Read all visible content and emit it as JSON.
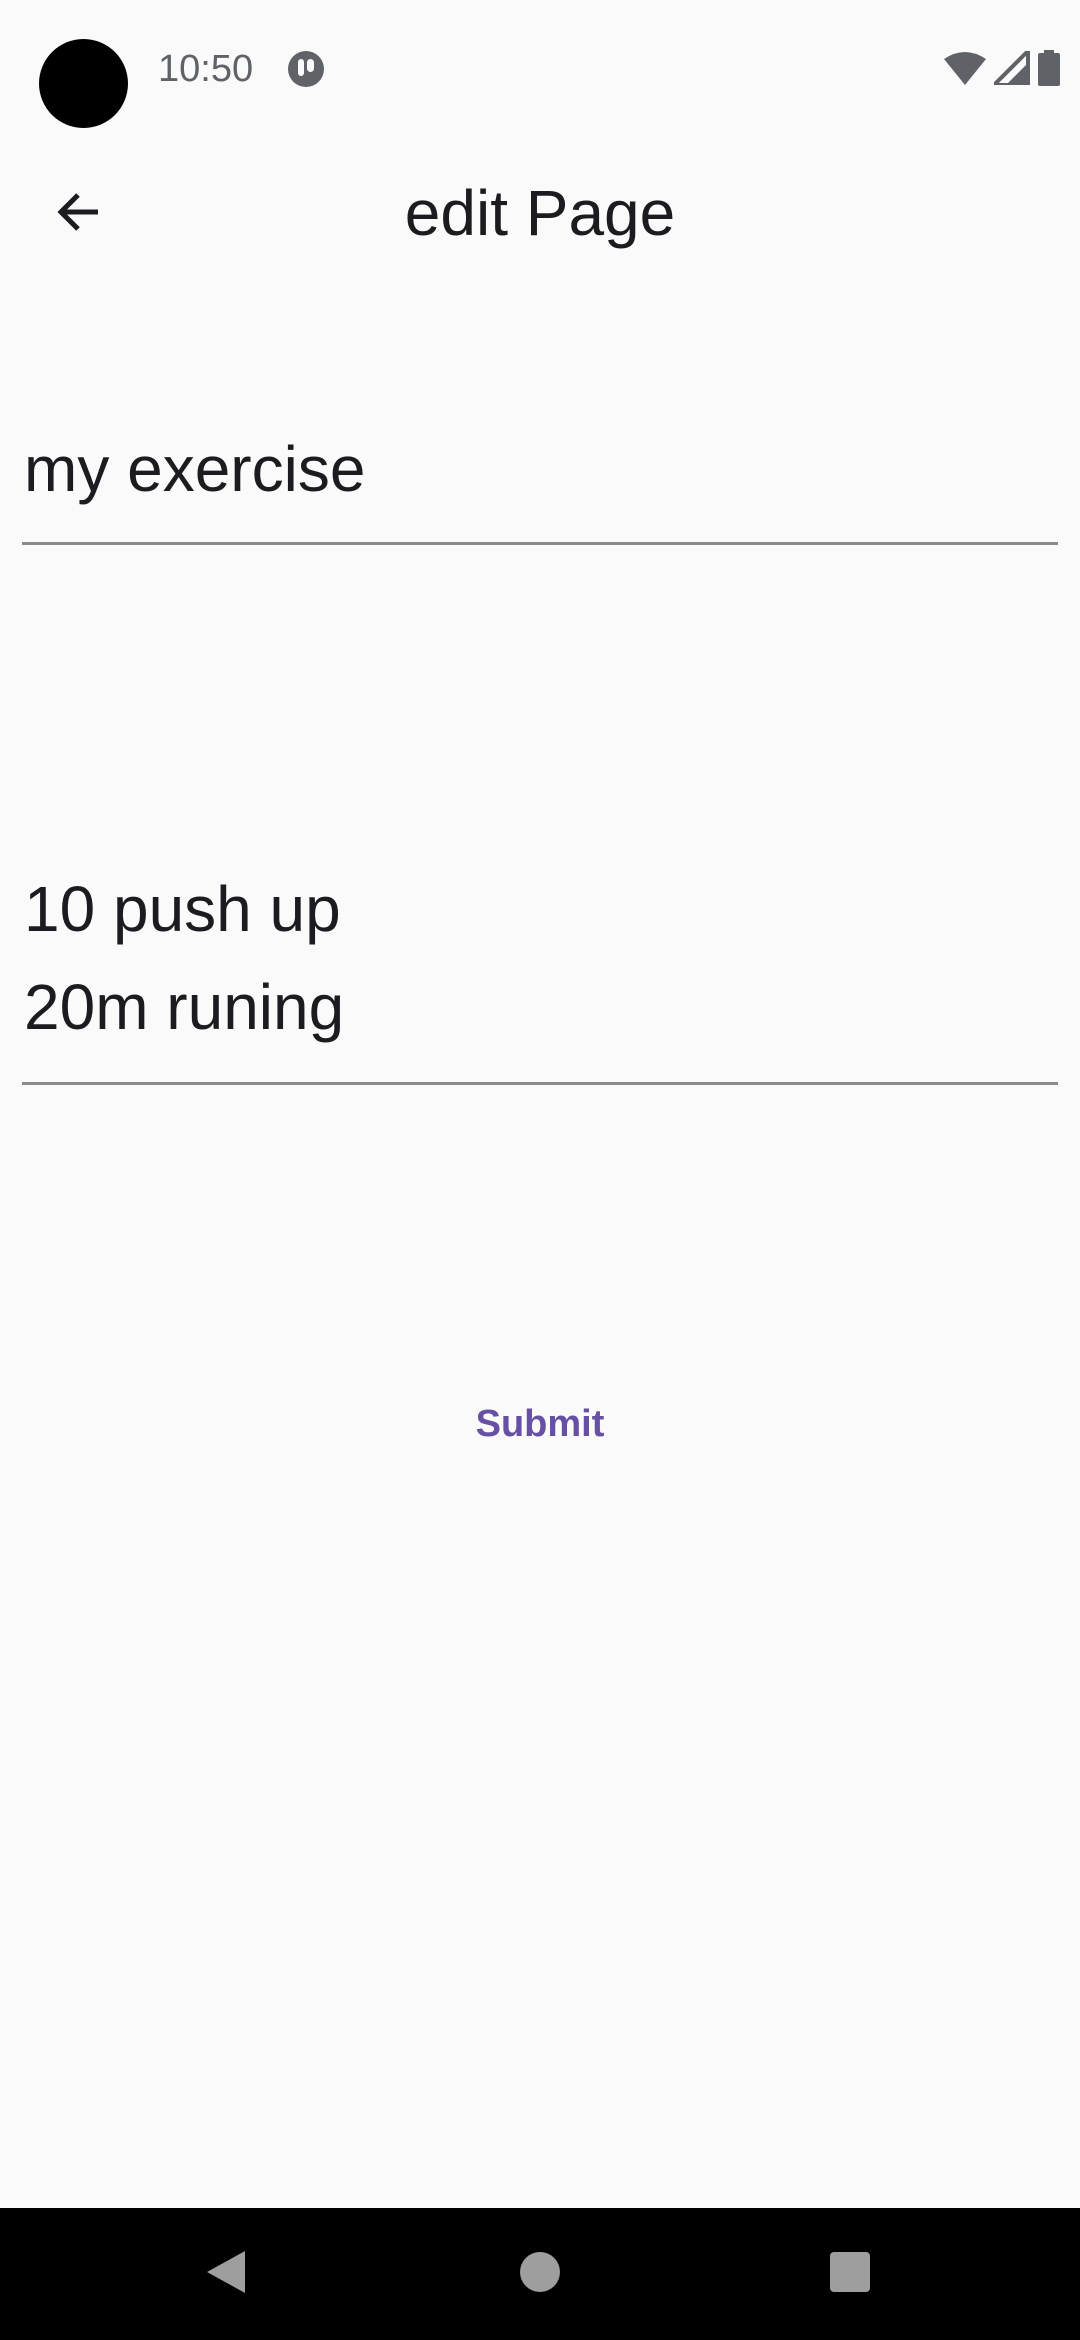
{
  "status_bar": {
    "time": "10:50",
    "icons": [
      "app-notification-icon",
      "wifi-icon",
      "signal-icon",
      "battery-icon"
    ]
  },
  "app_bar": {
    "title": "edit Page",
    "back_icon": "arrow-back-icon"
  },
  "form": {
    "title_value": "my exercise",
    "body_value": "10 push up\n20m runing",
    "submit_label": "Submit"
  },
  "nav_bar": {
    "icons": [
      "nav-back-icon",
      "nav-home-icon",
      "nav-recents-icon"
    ]
  },
  "colors": {
    "background": "#fafafa",
    "accent": "#6750a4",
    "text": "#1c1b1f",
    "underline": "#8a8a8a"
  }
}
